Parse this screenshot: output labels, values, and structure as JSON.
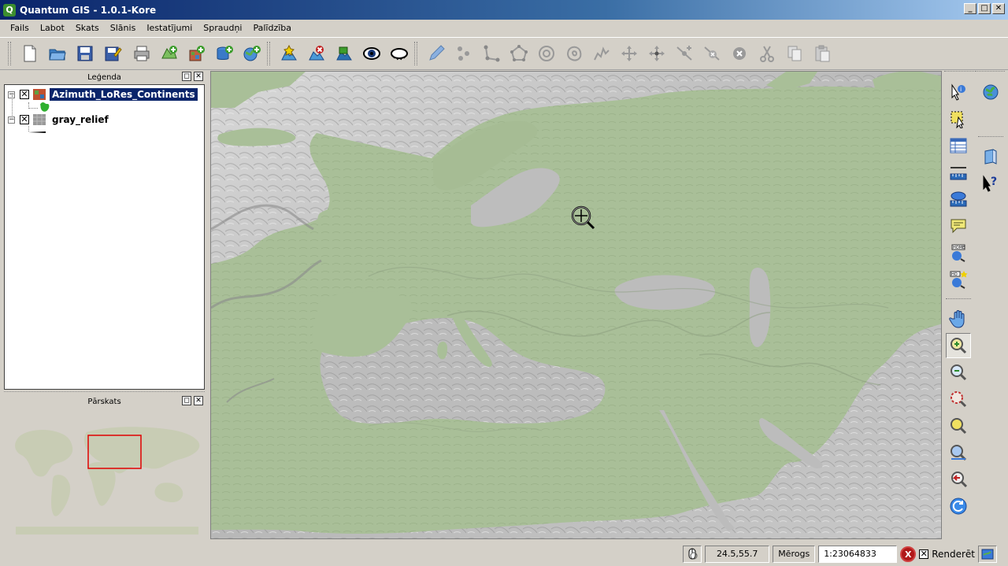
{
  "window": {
    "title": "Quantum GIS - 1.0.1-Kore",
    "logo_letter": "Q"
  },
  "menu": [
    "Fails",
    "Labot",
    "Skats",
    "Slānis",
    "Iestatījumi",
    "Spraudņi",
    "Palīdzība"
  ],
  "toolbar": {
    "icons": [
      "new-project-icon",
      "open-project-icon",
      "save-project-icon",
      "save-as-icon",
      "print-icon",
      "add-vector-layer-icon",
      "add-raster-layer-icon",
      "add-postgis-layer-icon",
      "add-wms-layer-icon",
      "new-vector-layer-icon",
      "remove-layer-icon",
      "add-all-to-overview-icon",
      "show-all-layers-icon",
      "hide-all-layers-icon",
      "toggle-editing-icon",
      "capture-point-icon",
      "capture-line-icon",
      "capture-polygon-icon",
      "add-ring-icon",
      "add-island-icon",
      "simplify-icon",
      "move-feature-icon",
      "move-vertex-icon",
      "add-vertex-icon",
      "delete-vertex-icon",
      "delete-selected-icon",
      "cut-features-icon",
      "copy-features-icon",
      "paste-features-icon"
    ]
  },
  "legend": {
    "title": "Leģenda",
    "layers": [
      {
        "name": "Azimuth_LoRes_Continents",
        "checked": "✕",
        "toggle": "−",
        "selected": true
      },
      {
        "name": "gray_relief",
        "checked": "✕",
        "toggle": "−",
        "selected": false
      }
    ]
  },
  "overview": {
    "title": "Pārskats"
  },
  "statusbar": {
    "coordinates": "24.5,55.7",
    "scale_label": "Mērogs",
    "scale_value": "1:23064833",
    "stop_label": "X",
    "render_label": "Renderēt",
    "render_checked": "✕"
  },
  "colors": {
    "land": "#a9bf98",
    "sea": "#bcbcbc",
    "selection": "#0a246a",
    "overview_extent": "#e00000"
  }
}
